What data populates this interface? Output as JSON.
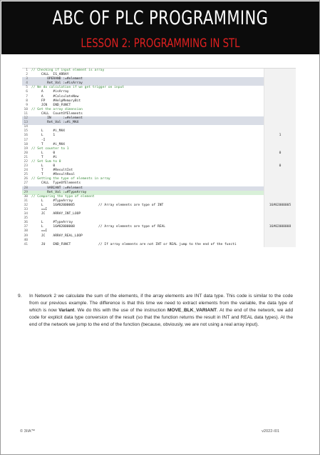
{
  "header": {
    "title": "ABC OF PLC PROGRAMMING",
    "subtitle": "LESSON 2: PROGRAMMING IN STL"
  },
  "code": [
    {
      "ln": "1",
      "text": "// Checking if input element is array",
      "cls": "cm",
      "val": "",
      "hl": ""
    },
    {
      "ln": "2",
      "text": "     CALL  IS_ARRAY",
      "cls": "",
      "val": "",
      "hl": ""
    },
    {
      "ln": "3",
      "text": "        OPERAND :=#element",
      "cls": "",
      "val": "",
      "hl": "hl"
    },
    {
      "ln": "4",
      "text": "        Ret_Val :=#isArray",
      "cls": "",
      "val": "",
      "hl": "hl"
    },
    {
      "ln": "5",
      "text": "// We do calculation if we get trigger on input",
      "cls": "cm",
      "val": "",
      "hl": ""
    },
    {
      "ln": "6",
      "text": "     A     #isArray",
      "cls": "",
      "val": "",
      "hl": ""
    },
    {
      "ln": "7",
      "text": "     A     #CalculateNow",
      "cls": "",
      "val": "",
      "hl": ""
    },
    {
      "ln": "8",
      "text": "     FP    #HelpMemoryBit",
      "cls": "",
      "val": "",
      "hl": ""
    },
    {
      "ln": "9",
      "text": "     JCN   END_FUNCT",
      "cls": "",
      "val": "",
      "hl": ""
    },
    {
      "ln": "10",
      "text": "// Get the array dimension",
      "cls": "cm",
      "val": "",
      "hl": ""
    },
    {
      "ln": "11",
      "text": "     CALL  CountOfElements",
      "cls": "",
      "val": "",
      "hl": ""
    },
    {
      "ln": "12",
      "text": "        IN      :=#element",
      "cls": "",
      "val": "",
      "hl": "hl"
    },
    {
      "ln": "13",
      "text": "        Ret_Val :=#i_MAX",
      "cls": "",
      "val": "",
      "hl": "hl"
    },
    {
      "ln": "14",
      "text": "",
      "cls": "",
      "val": "",
      "hl": ""
    },
    {
      "ln": "15",
      "text": "     L     #i_MAX",
      "cls": "",
      "val": "",
      "hl": ""
    },
    {
      "ln": "16",
      "text": "     L     1",
      "cls": "",
      "val": "1",
      "hl": ""
    },
    {
      "ln": "17",
      "text": "     -I",
      "cls": "",
      "val": "",
      "hl": ""
    },
    {
      "ln": "18",
      "text": "     T     #i_MAX",
      "cls": "",
      "val": "",
      "hl": ""
    },
    {
      "ln": "19",
      "text": "// Set counter to 1",
      "cls": "cm",
      "val": "",
      "hl": ""
    },
    {
      "ln": "20",
      "text": "     L     0",
      "cls": "",
      "val": "0",
      "hl": ""
    },
    {
      "ln": "21",
      "text": "     T     #i",
      "cls": "",
      "val": "",
      "hl": ""
    },
    {
      "ln": "22",
      "text": "// Set Sum to 0",
      "cls": "cm",
      "val": "",
      "hl": ""
    },
    {
      "ln": "23",
      "text": "     L     0",
      "cls": "",
      "val": "0",
      "hl": ""
    },
    {
      "ln": "24",
      "text": "     T     #ResultInt",
      "cls": "",
      "val": "",
      "hl": ""
    },
    {
      "ln": "25",
      "text": "     T     #ResultReal",
      "cls": "",
      "val": "",
      "hl": ""
    },
    {
      "ln": "26",
      "text": "// Getting the type of elements in array",
      "cls": "cm",
      "val": "",
      "hl": ""
    },
    {
      "ln": "27",
      "text": "     CALL  TypeOfElements",
      "cls": "",
      "val": "",
      "hl": ""
    },
    {
      "ln": "28",
      "text": "        VARIANT :=#element",
      "cls": "",
      "val": "",
      "hl": "hl"
    },
    {
      "ln": "29",
      "text": "        Ret_Val :=#TypeArray",
      "cls": "",
      "val": "",
      "hl": "gr"
    },
    {
      "ln": "30",
      "text": "// Comparing the type of element",
      "cls": "cm",
      "val": "",
      "hl": ""
    },
    {
      "ln": "31",
      "text": "     L     #TypeArray",
      "cls": "",
      "val": "",
      "hl": ""
    },
    {
      "ln": "32",
      "text": "     L     16#02000005            // Array elements are type of INT",
      "cls": "",
      "val": "16#02000005",
      "hl": ""
    },
    {
      "ln": "33",
      "text": "     ==I",
      "cls": "",
      "val": "",
      "hl": ""
    },
    {
      "ln": "34",
      "text": "     JC    ARRAY_INT_LOOP",
      "cls": "",
      "val": "",
      "hl": ""
    },
    {
      "ln": "35",
      "text": "",
      "cls": "",
      "val": "",
      "hl": ""
    },
    {
      "ln": "36",
      "text": "     L     #TypeArray",
      "cls": "",
      "val": "",
      "hl": ""
    },
    {
      "ln": "37",
      "text": "     L     16#02000008            // Array elements are type of REAL",
      "cls": "",
      "val": "16#02000008",
      "hl": ""
    },
    {
      "ln": "38",
      "text": "     ==I",
      "cls": "",
      "val": "",
      "hl": ""
    },
    {
      "ln": "39",
      "text": "     JC    ARRAY_REAL_LOOP",
      "cls": "",
      "val": "",
      "hl": ""
    },
    {
      "ln": "40",
      "text": "",
      "cls": "",
      "val": "",
      "hl": ""
    },
    {
      "ln": "41",
      "text": "     JU    END_FUNCT              // If array elements are not INT or REAL jump to the end of the functi",
      "cls": "",
      "val": "",
      "hl": ""
    }
  ],
  "paragraph": {
    "number": "9.",
    "text_1": "In Network 2 we calculate the sum of the elements, if the array elements are INT data type. This code is similar to the code from our previous example. The difference is that this time we need to extract elements from the variable, the data type of which is now ",
    "bold_1": "Variant",
    "text_2": ". We do this with the use of the instruction ",
    "bold_2": "MOVE_BLK_VARIANT",
    "text_3": ". At the end of the network, we add code for explicit data type conversion of the result (so that the function returns the result in INT and REAL data types). At the end of the network we jump to the end of the function (because, obviously, we are not using a real array input)."
  },
  "footer": {
    "left": "© 3IIA™",
    "right": "v2022-I01"
  }
}
